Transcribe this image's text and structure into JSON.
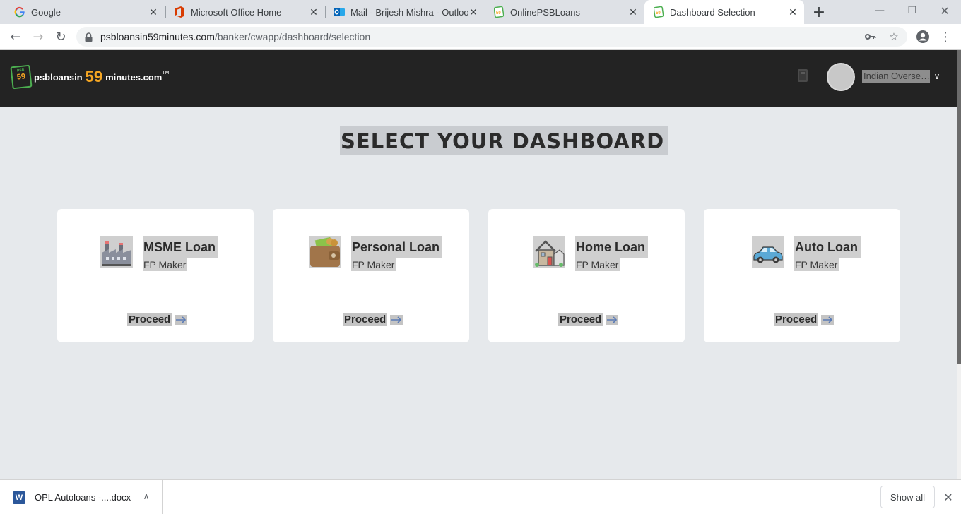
{
  "browser": {
    "tabs": [
      {
        "title": "Google",
        "favicon": "google-icon",
        "active": false
      },
      {
        "title": "Microsoft Office Home",
        "favicon": "office-icon",
        "active": false
      },
      {
        "title": "Mail - Brijesh Mishra - Outlook",
        "favicon": "outlook-icon",
        "active": false
      },
      {
        "title": "OnlinePSBLoans",
        "favicon": "psb-icon",
        "active": false
      },
      {
        "title": "Dashboard Selection",
        "favicon": "psb-icon",
        "active": true
      }
    ],
    "address": {
      "host": "psbloansin59minutes.com",
      "path": "/banker/cwapp/dashboard/selection"
    }
  },
  "app": {
    "logo": {
      "prefix": "psbloansin",
      "number": "59",
      "suffix": "minutes.com",
      "tm": "TM",
      "badge": "59",
      "badge_top": "PSB"
    },
    "user": {
      "bank": "Indian Overseas Bank"
    }
  },
  "page": {
    "title": "SELECT YOUR DASHBOARD",
    "cards": [
      {
        "name": "MSME Loan",
        "role": "FP Maker",
        "action": "Proceed",
        "icon": "factory-icon"
      },
      {
        "name": "Personal Loan",
        "role": "FP Maker",
        "action": "Proceed",
        "icon": "wallet-icon"
      },
      {
        "name": "Home Loan",
        "role": "FP Maker",
        "action": "Proceed",
        "icon": "house-icon"
      },
      {
        "name": "Auto Loan",
        "role": "FP Maker",
        "action": "Proceed",
        "icon": "car-icon"
      }
    ]
  },
  "downloads": {
    "file": "OPL Autoloans -....docx",
    "show_all": "Show all"
  },
  "colors": {
    "appbar": "#232323",
    "page_bg": "#e6e9ec",
    "accent_orange": "#f5a623",
    "accent_green": "#4caf50",
    "arrow_blue": "#5b7bb5"
  }
}
